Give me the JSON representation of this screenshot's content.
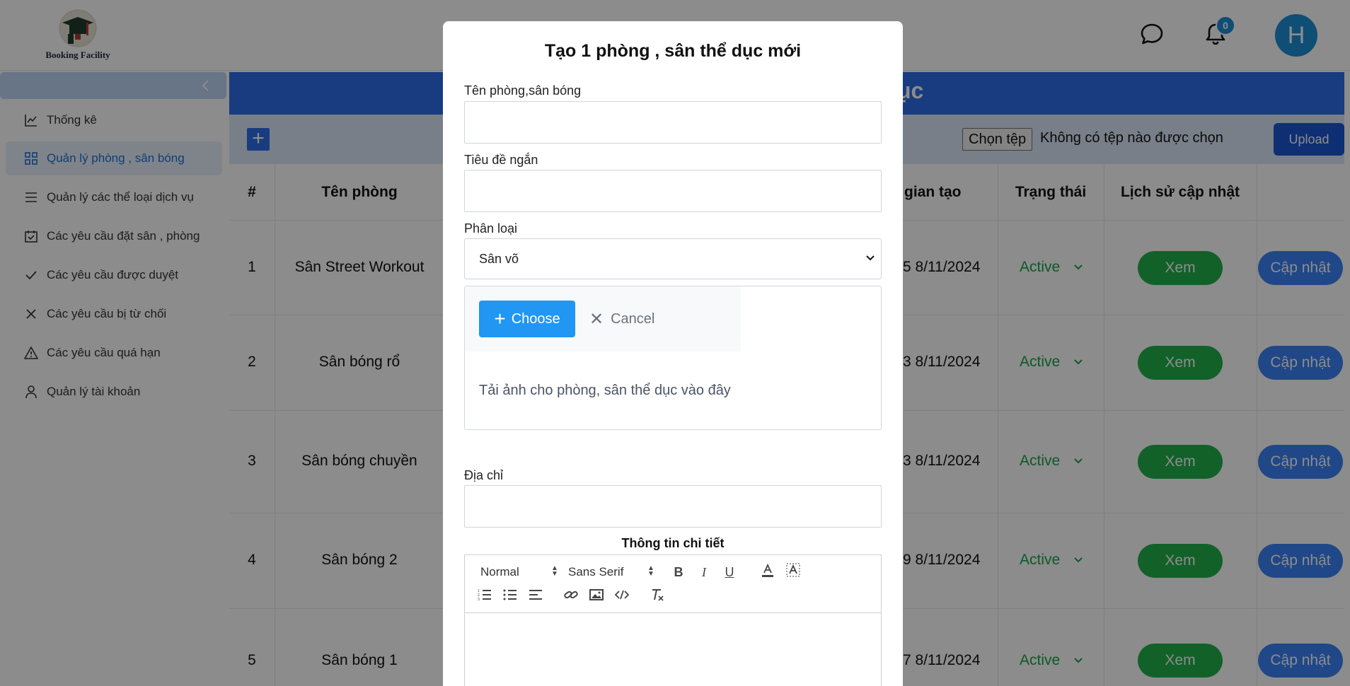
{
  "header": {
    "logo_text": "Booking Facility",
    "notification_count": "0",
    "avatar_initial": "H"
  },
  "sidebar": {
    "items": [
      {
        "label": "Thống kê",
        "icon": "chart-line-icon"
      },
      {
        "label": "Quản lý phòng , sân bóng",
        "icon": "grid-icon"
      },
      {
        "label": "Quản lý các thể loại dịch vụ",
        "icon": "list-icon"
      },
      {
        "label": "Các yêu cầu đặt sân , phòng",
        "icon": "calendar-check-icon"
      },
      {
        "label": "Các yêu cầu được duyệt",
        "icon": "check-icon"
      },
      {
        "label": "Các yêu cầu bị từ chối",
        "icon": "x-icon"
      },
      {
        "label": "Các yêu cầu quá hạn",
        "icon": "warning-icon"
      },
      {
        "label": "Quản lý tài khoản",
        "icon": "user-icon"
      }
    ],
    "active_index": 1
  },
  "main": {
    "banner_title_visible": "ục",
    "file_choose_label": "Chọn tệp",
    "file_none_label": "Không có tệp nào được chọn",
    "upload_label": "Upload",
    "columns": {
      "index": "#",
      "name": "Tên phòng",
      "created": "gian tạo",
      "status": "Trạng thái",
      "history": "Lịch sử cập nhật"
    },
    "rows": [
      {
        "index": "1",
        "name": "Sân Street Workout",
        "created": "5 8/11/2024",
        "status": "Active",
        "view": "Xem",
        "update": "Cập nhật"
      },
      {
        "index": "2",
        "name": "Sân bóng rổ",
        "created": "3 8/11/2024",
        "status": "Active",
        "view": "Xem",
        "update": "Cập nhật"
      },
      {
        "index": "3",
        "name": "Sân bóng chuyền",
        "created": "3 8/11/2024",
        "status": "Active",
        "view": "Xem",
        "update": "Cập nhật"
      },
      {
        "index": "4",
        "name": "Sân bóng 2",
        "created": "9 8/11/2024",
        "status": "Active",
        "view": "Xem",
        "update": "Cập nhật"
      },
      {
        "index": "5",
        "name": "Sân bóng 1",
        "created": "7 8/11/2024",
        "status": "Active",
        "view": "Xem",
        "update": "Cập nhật"
      }
    ]
  },
  "modal": {
    "title": "Tạo 1 phòng , sân thể dục mới",
    "name_label": "Tên phòng,sân bóng",
    "name_value": "",
    "short_title_label": "Tiêu đề ngắn",
    "short_title_value": "",
    "category_label": "Phân loại",
    "category_selected": "Sân võ",
    "choose_label": "Choose",
    "cancel_label": "Cancel",
    "upload_hint": "Tải ảnh cho phòng, sân thể dục vào đây",
    "address_label": "Địa chỉ",
    "address_value": "",
    "detail_title": "Thông tin chi tiết",
    "editor": {
      "format_select": "Normal",
      "font_select": "Sans Serif"
    }
  },
  "colors": {
    "primary": "#2d6ee8",
    "status_green": "#16a34a",
    "view_button": "#22b14c",
    "update_button": "#3b82f6",
    "choose_button": "#2196f3"
  }
}
